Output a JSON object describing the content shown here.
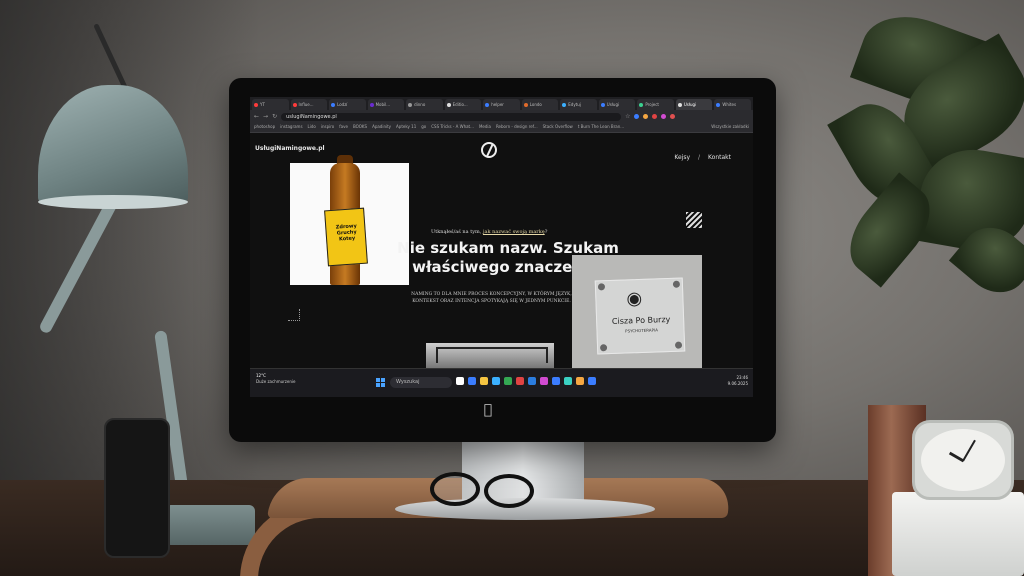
{
  "browser": {
    "tabs": [
      {
        "label": "YT",
        "color": "#ff3b3b"
      },
      {
        "label": "Influe...",
        "color": "#ff3b3b"
      },
      {
        "label": "Lodzí",
        "color": "#3b7dff"
      },
      {
        "label": "Mobil...",
        "color": "#6b2bd1"
      },
      {
        "label": "dinno",
        "color": "#999999"
      },
      {
        "label": "Editio...",
        "color": "#e0e0e0"
      },
      {
        "label": "helper",
        "color": "#3b7dff"
      },
      {
        "label": "Londo",
        "color": "#e06b2b"
      },
      {
        "label": "Edytuj",
        "color": "#3bb0ff"
      },
      {
        "label": "Usługi",
        "color": "#3b7dff"
      },
      {
        "label": "Project",
        "color": "#3bd18f"
      },
      {
        "label": "Usługi",
        "color": "#e0e0e0"
      },
      {
        "label": "Whites",
        "color": "#3b7dff"
      }
    ],
    "active_tab_index": 11,
    "url": "uslugiNamingowe.pl",
    "bookmarks": [
      "photoshop",
      "instagrams",
      "Lido",
      "inspiro",
      "fave",
      "BOOKS",
      "Apadinity",
      "Apteky 11",
      "go",
      "CSS Tricks - A What...",
      "Media",
      "Reborn - design ref...",
      "Stack Overflow",
      "t Burn The Lean Bran..."
    ],
    "bookmarks_end": "Wszystkie zakładki"
  },
  "site": {
    "logo": "UsługiNamingowe.pl",
    "nav": [
      "Kejsy",
      "Kontakt"
    ],
    "nav_separator": "/",
    "eyebrow_before": "Utknąłeś/aś na tym, ",
    "eyebrow_link": "jak nazwać swoją markę",
    "eyebrow_after": "?",
    "hero_title": "Nie szukam nazw. Szukam właściwego znaczenia.",
    "hero_copy": "NAMING TO DLA MNIE PROCES KONCEPCYJNY, W KTÓRYM JĘZYK, KONTEKST ORAZ INTENCJA SPOTYKAJĄ SIĘ W JEDNYM PUNKCIE.",
    "bottle_label": "Zdrowy Gruchy Kotey",
    "sign_title": "Cisza Po Burzy",
    "sign_subtitle": "PSYCHOTERAPIA"
  },
  "taskbar": {
    "weather_temp": "12°C",
    "weather_desc": "Duże zachmurzenie",
    "search_placeholder": "Wyszukaj",
    "time": "23:46",
    "date": "9.06.2025",
    "pinned_icon_colors": [
      "#ffffff",
      "#3b7dff",
      "#f5c542",
      "#3bb0ff",
      "#34a853",
      "#e04343",
      "#2b7de0",
      "#d14bd1",
      "#3b7dff",
      "#3bd1c2",
      "#f5a742",
      "#3b7dff"
    ]
  },
  "scene": {
    "monitor_brand_icon": "apple-icon",
    "clock_icon": "analog-clock-icon"
  }
}
